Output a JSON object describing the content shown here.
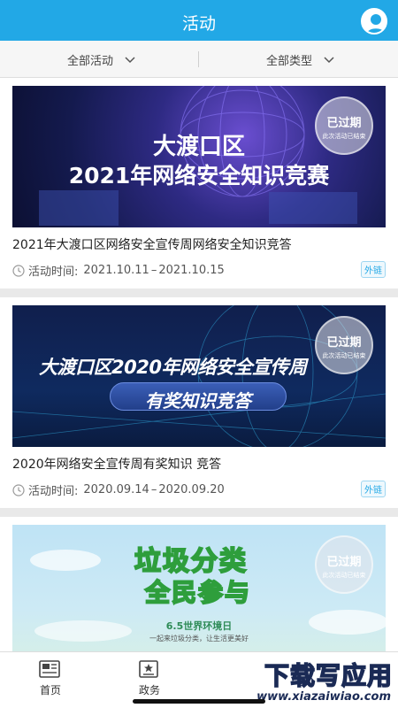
{
  "header": {
    "title": "活动",
    "user_icon": "user-icon"
  },
  "filters": [
    {
      "label": "全部活动",
      "icon": "chevron-down-icon"
    },
    {
      "label": "全部类型",
      "icon": "chevron-down-icon"
    }
  ],
  "activities": [
    {
      "banner_line1": "大渡口区",
      "banner_line2": "2021年网络安全知识竞赛",
      "stamp_main": "已过期",
      "stamp_sub": "此次活动已结束",
      "title": "2021年大渡口区网络安全宣传周网络安全知识竞答",
      "time_label": "活动时间:",
      "date_start": "2021.10.11",
      "date_sep": "–",
      "date_end": "2021.10.15",
      "badge": "外链"
    },
    {
      "banner_line1": "大渡口区2020年网络安全宣传周",
      "banner_line2": "有奖知识竞答",
      "stamp_main": "已过期",
      "stamp_sub": "此次活动已结束",
      "title": "2020年网络安全宣传周有奖知识 竞答",
      "time_label": "活动时间:",
      "date_start": "2020.09.14",
      "date_sep": "–",
      "date_end": "2020.09.20",
      "badge": "外链"
    },
    {
      "banner_line1": "垃圾分类",
      "banner_line2": "全民参与",
      "banner_line3": "6.5世界环境日",
      "banner_line4": "一起来垃圾分类，让生活更美好",
      "stamp_main": "已过期",
      "stamp_sub": "此次活动已结束"
    }
  ],
  "tabbar": [
    {
      "label": "首页",
      "icon": "newspaper-icon"
    },
    {
      "label": "政务",
      "icon": "government-icon"
    }
  ],
  "watermark": {
    "line1": "下载写应用",
    "line2": "www.xiazaiwiao.com"
  },
  "colors": {
    "primary": "#22a8e6",
    "background": "#e9e9e9",
    "card": "#ffffff"
  }
}
